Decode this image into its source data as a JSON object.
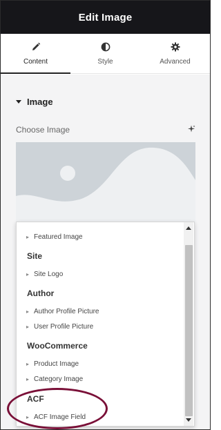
{
  "header": {
    "title": "Edit Image"
  },
  "tabs": [
    {
      "label": "Content",
      "icon": "pencil-icon",
      "active": true
    },
    {
      "label": "Style",
      "icon": "contrast-icon",
      "active": false
    },
    {
      "label": "Advanced",
      "icon": "gear-icon",
      "active": false
    }
  ],
  "section": {
    "title": "Image"
  },
  "image_control": {
    "label": "Choose Image",
    "ai_icon": "sparkle-icon"
  },
  "dropdown": {
    "items": [
      {
        "kind": "item",
        "label": "Featured Image"
      },
      {
        "kind": "group",
        "label": "Site"
      },
      {
        "kind": "item",
        "label": "Site Logo"
      },
      {
        "kind": "group",
        "label": "Author"
      },
      {
        "kind": "item",
        "label": "Author Profile Picture"
      },
      {
        "kind": "item",
        "label": "User Profile Picture"
      },
      {
        "kind": "group",
        "label": "WooCommerce"
      },
      {
        "kind": "item",
        "label": "Product Image"
      },
      {
        "kind": "item",
        "label": "Category Image"
      },
      {
        "kind": "group",
        "label": "ACF"
      },
      {
        "kind": "item",
        "label": "ACF Image Field"
      }
    ],
    "bullet": "▸"
  },
  "colors": {
    "header_bg": "#16161a",
    "panel_bg": "#f4f4f5",
    "highlight": "#7a1038"
  }
}
